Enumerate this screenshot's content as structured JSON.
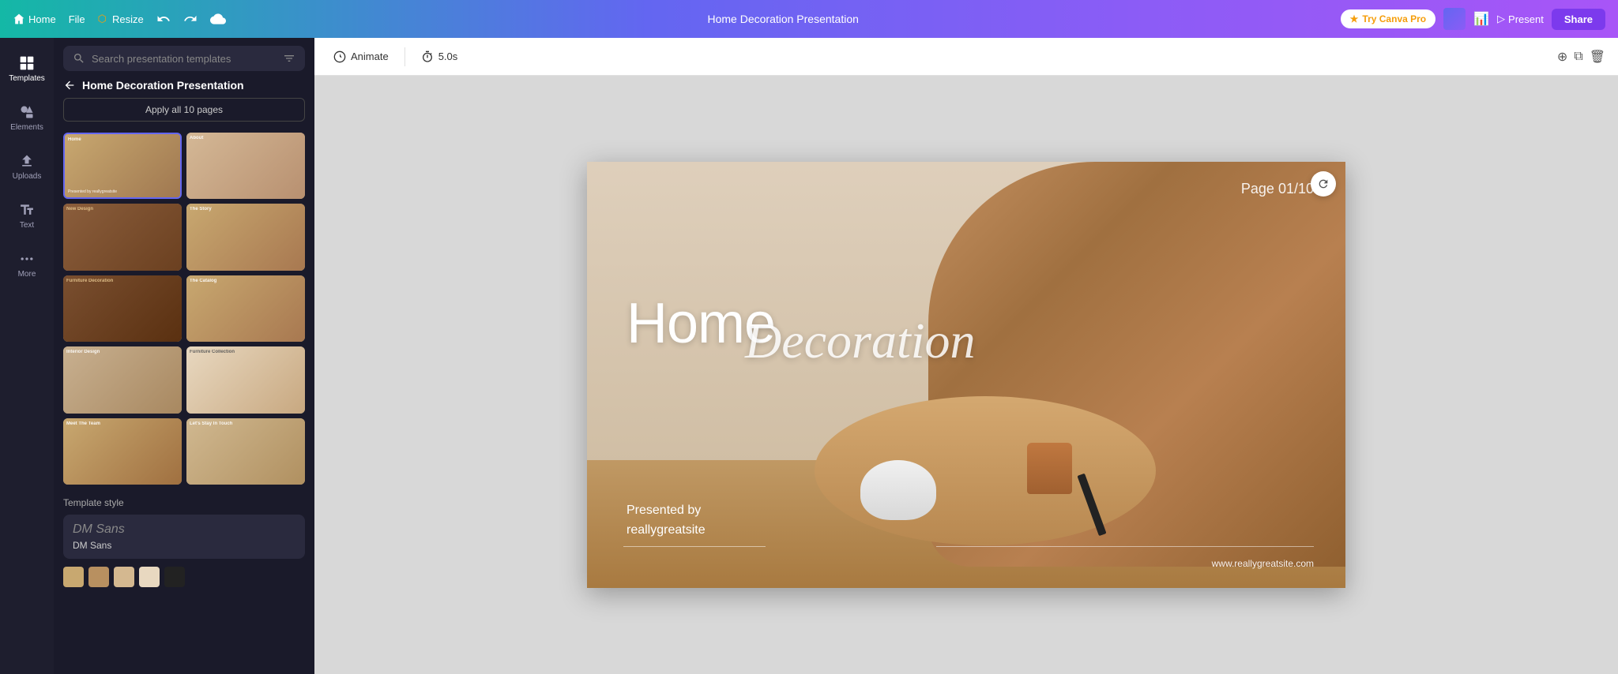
{
  "topbar": {
    "home_label": "Home",
    "file_label": "File",
    "resize_label": "Resize",
    "title": "Home Decoration Presentation",
    "try_pro_label": "Try Canva Pro",
    "present_label": "Present",
    "share_label": "Share"
  },
  "sidebar": {
    "items": [
      {
        "id": "templates",
        "label": "Templates",
        "icon": "grid"
      },
      {
        "id": "elements",
        "label": "Elements",
        "icon": "shapes"
      },
      {
        "id": "uploads",
        "label": "Uploads",
        "icon": "upload"
      },
      {
        "id": "text",
        "label": "Text",
        "icon": "text"
      },
      {
        "id": "more",
        "label": "More",
        "icon": "dots"
      }
    ]
  },
  "templates_panel": {
    "search_placeholder": "Search presentation templates",
    "back_title": "Home Decoration Presentation",
    "apply_all_label": "Apply all 10 pages",
    "template_style_label": "Template style",
    "font_name": "DM Sans",
    "font_preview": "DM Sans",
    "color_swatches": [
      "#c8a870",
      "#b89060",
      "#d4b890",
      "#e8d8c0",
      "#222222"
    ]
  },
  "canvas": {
    "animate_label": "Animate",
    "duration_label": "5.0s",
    "slide_page": "Page 01/10",
    "title_home": "Home",
    "title_deco": "Decoration",
    "presented_by": "Presented by",
    "site_name": "reallygreatsite",
    "website": "www.reallygreatsite.com"
  },
  "thumbnail_labels": [
    "Home",
    "About",
    "New Design",
    "The Story",
    "Furniture Decoration",
    "The Catalog",
    "Interior Design",
    "Furniture Collection",
    "Meet The Team",
    "Let's Stay In Touch"
  ]
}
